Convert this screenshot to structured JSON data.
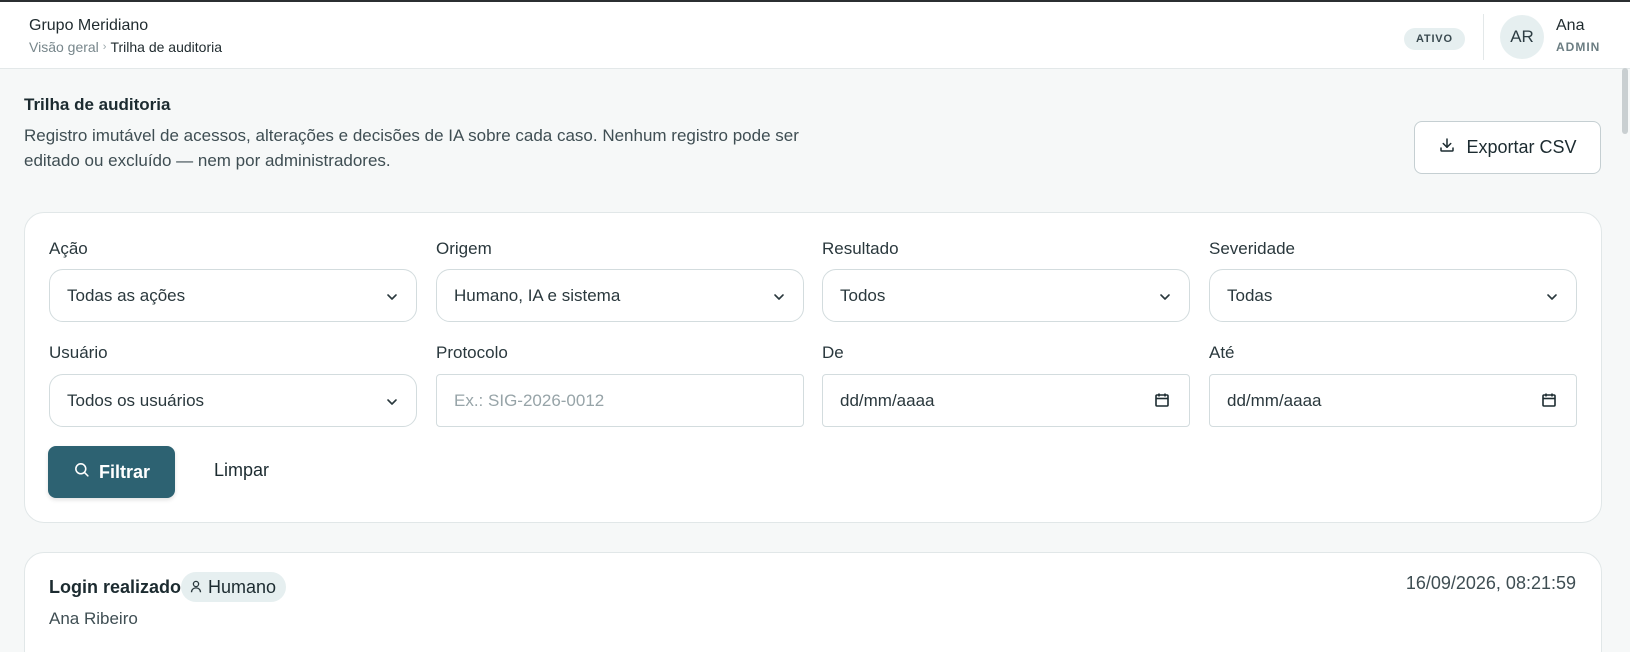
{
  "header": {
    "org_name": "Grupo Meridiano",
    "breadcrumb": [
      "Visão geral",
      "Trilha de auditoria"
    ],
    "breadcrumb_separator": "›",
    "status_badge": "ATIVO",
    "user": {
      "initials": "AR",
      "name": "Ana",
      "role": "ADMIN"
    }
  },
  "page": {
    "title": "Trilha de auditoria",
    "description": "Registro imutável de acessos, alterações e decisões de IA sobre cada caso. Nenhum registro pode ser editado ou excluído — nem por administradores.",
    "export_label": "Exportar CSV"
  },
  "filters": {
    "action": {
      "label": "Ação",
      "value": "Todas as ações"
    },
    "origin": {
      "label": "Origem",
      "value": "Humano, IA e sistema"
    },
    "result": {
      "label": "Resultado",
      "value": "Todos"
    },
    "severity": {
      "label": "Severidade",
      "value": "Todas"
    },
    "user": {
      "label": "Usuário",
      "value": "Todos os usuários"
    },
    "protocol": {
      "label": "Protocolo",
      "placeholder": "Ex.: SIG-2026-0012"
    },
    "from": {
      "label": "De",
      "placeholder": "dd/mm/aaaa"
    },
    "to": {
      "label": "Até",
      "placeholder": "dd/mm/aaaa"
    },
    "filter_button": "Filtrar",
    "clear_button": "Limpar"
  },
  "log_entries": [
    {
      "action": "Login realizado",
      "origin": "Humano",
      "user": "Ana Ribeiro",
      "timestamp": "16/09/2026, 08:21:59"
    }
  ],
  "icons": {
    "export": "download-icon",
    "select": "chevron-down-icon",
    "date": "calendar-icon",
    "filter": "search-icon",
    "origin_human": "person-icon"
  },
  "colors": {
    "primary": "#2d6272",
    "badge_bg": "#e6eff0",
    "page_bg": "#f6f8f8"
  }
}
